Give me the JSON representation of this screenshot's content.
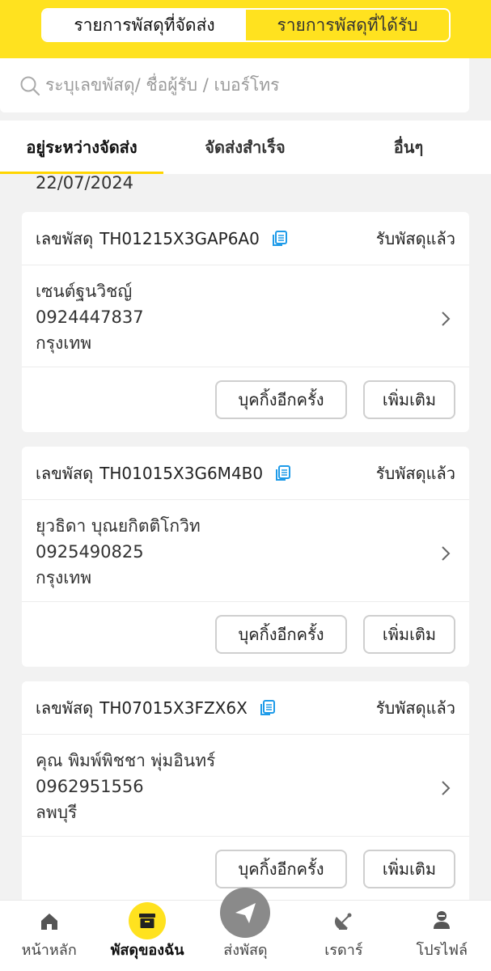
{
  "header": {
    "tabs": [
      {
        "label": "รายการพัสดุที่จัดส่ง",
        "active": true
      },
      {
        "label": "รายการพัสดุที่ได้รับ",
        "active": false
      }
    ],
    "accent_color": "#ffe21f"
  },
  "search": {
    "placeholder": "ระบุเลขพัสดุ/ ชื่อผู้รับ / เบอร์โทร",
    "icon": "search-icon"
  },
  "status_tabs": [
    {
      "label": "อยู่ระหว่างจัดส่ง",
      "active": true
    },
    {
      "label": "จัดส่งสำเร็จ",
      "active": false
    },
    {
      "label": "อื่นๆ",
      "active": false
    }
  ],
  "date": "22/07/2024",
  "parcels": [
    {
      "label": "เลขพัสดุ",
      "tracking": "TH01215X3GAP6A0",
      "status": "รับพัสดุแล้ว",
      "name": "เซนต์ฐนวิชญ์",
      "phone": "0924447837",
      "province": "กรุงเทพ",
      "rebook_label": "บุคกิ้งอีกครั้ง",
      "more_label": "เพิ่มเติม"
    },
    {
      "label": "เลขพัสดุ",
      "tracking": "TH01015X3G6M4B0",
      "status": "รับพัสดุแล้ว",
      "name": "ยุวธิดา บุณยกิตติโกวิท",
      "phone": "0925490825",
      "province": "กรุงเทพ",
      "rebook_label": "บุคกิ้งอีกครั้ง",
      "more_label": "เพิ่มเติม"
    },
    {
      "label": "เลขพัสดุ",
      "tracking": "TH07015X3FZX6X",
      "status": "รับพัสดุแล้ว",
      "name": "คุณ พิมพ์พิชชา พุ่มอินทร์",
      "phone": "0962951556",
      "province": "ลพบุรี",
      "rebook_label": "บุคกิ้งอีกครั้ง",
      "more_label": "เพิ่มเติม"
    }
  ],
  "bottom_nav": [
    {
      "label": "หน้าหลัก",
      "icon": "home-icon",
      "active": false
    },
    {
      "label": "พัสดุของฉัน",
      "icon": "box-icon",
      "active": true
    },
    {
      "label": "ส่งพัสดุ",
      "icon": "send-icon",
      "active": false
    },
    {
      "label": "เรดาร์",
      "icon": "radar-icon",
      "active": false
    },
    {
      "label": "โปรไฟล์",
      "icon": "profile-icon",
      "active": false
    }
  ]
}
